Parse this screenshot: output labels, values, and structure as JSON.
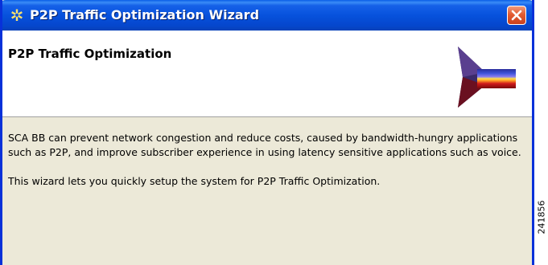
{
  "window": {
    "title": "P2P Traffic Optimization Wizard",
    "icon": "wizard-app-icon",
    "close_icon": "close-icon"
  },
  "header": {
    "title": "P2P Traffic Optimization",
    "banner_icon": "wizard-arrow-banner-icon"
  },
  "body": {
    "paragraph1": "SCA BB can prevent network congestion and reduce costs, caused by bandwidth-hungry applications such as P2P, and improve subscriber experience in using latency sensitive applications such as voice.",
    "paragraph2": "This wizard lets you quickly setup the system for P2P Traffic Optimization."
  },
  "figure_id": "241856",
  "colors": {
    "titlebar": "#0752dd",
    "close_button": "#e45c32",
    "dialog_background": "#ece9d8",
    "header_background": "#ffffff"
  }
}
